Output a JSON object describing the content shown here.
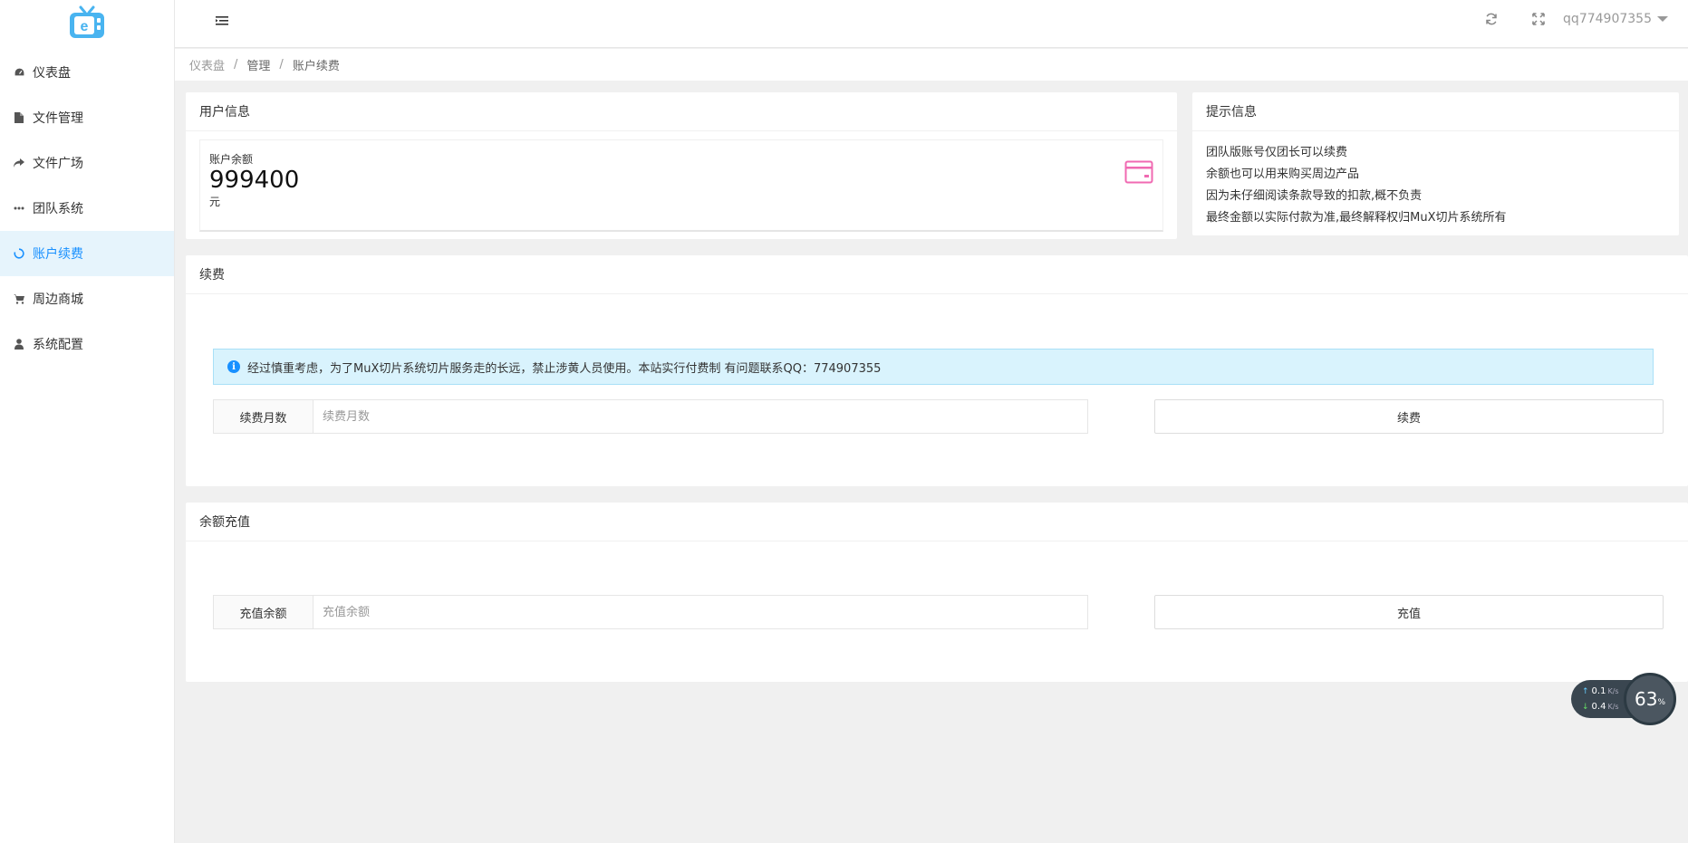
{
  "sidebar": {
    "items": [
      {
        "label": "仪表盘",
        "icon": "dashboard-icon"
      },
      {
        "label": "文件管理",
        "icon": "file-icon"
      },
      {
        "label": "文件广场",
        "icon": "share-icon"
      },
      {
        "label": "团队系统",
        "icon": "ellipsis-icon"
      },
      {
        "label": "账户续费",
        "icon": "loading-circle-icon",
        "active": true
      },
      {
        "label": "周边商城",
        "icon": "cart-icon"
      },
      {
        "label": "系统配置",
        "icon": "user-icon"
      }
    ]
  },
  "header": {
    "username": "qq774907355"
  },
  "breadcrumb": {
    "items": [
      "仪表盘",
      "管理",
      "账户续费"
    ]
  },
  "user_info": {
    "title": "用户信息",
    "balance_label": "账户余额",
    "balance_value": "999400",
    "balance_unit": "元"
  },
  "tips": {
    "title": "提示信息",
    "lines": [
      "团队版账号仅团长可以续费",
      "余额也可以用来购买周边产品",
      "因为未仔细阅读条款导致的扣款,概不负责",
      "最终金额以实际付款为准,最终解释权归MuX切片系统所有"
    ]
  },
  "renew": {
    "title": "续费",
    "notice": "经过慎重考虑，为了MuX切片系统切片服务走的长远，禁止涉黄人员使用。本站实行付费制 有问题联系QQ：774907355",
    "months_label": "续费月数",
    "months_placeholder": "续费月数",
    "button": "续费"
  },
  "recharge": {
    "title": "余额充值",
    "amount_label": "充值余额",
    "amount_placeholder": "充值余额",
    "button": "充值"
  },
  "speed_widget": {
    "upload": "0.1",
    "download": "0.4",
    "unit": "K/s",
    "percent": "63",
    "percent_sign": "%"
  },
  "colors": {
    "accent": "#1890ff",
    "active_bg": "#e6f4fc",
    "notice_bg": "#d9f3fd",
    "card_icon": "#f06ab2"
  }
}
